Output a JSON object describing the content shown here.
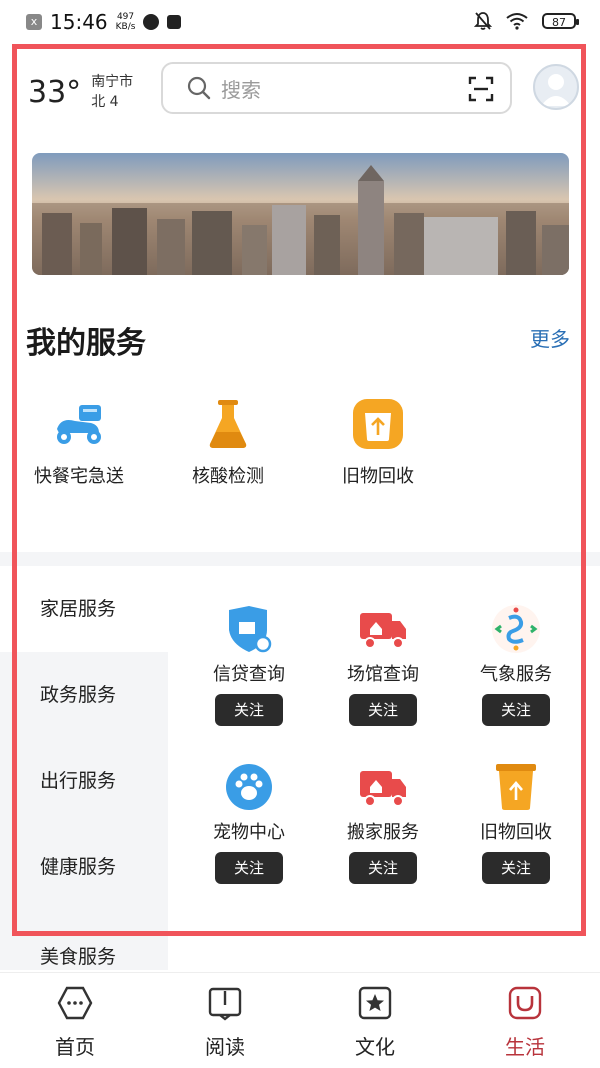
{
  "status_bar": {
    "badge": "x",
    "time": "15:46",
    "speed_value": "497",
    "speed_unit": "KB/s",
    "battery": "87"
  },
  "weather": {
    "temperature": "33°",
    "city": "南宁市",
    "wind": "北 4"
  },
  "search": {
    "placeholder": "搜索"
  },
  "my_services": {
    "title": "我的服务",
    "more": "更多",
    "items": [
      {
        "label": "快餐宅急送",
        "icon": "delivery-scooter-icon"
      },
      {
        "label": "核酸检测",
        "icon": "test-flask-icon"
      },
      {
        "label": "旧物回收",
        "icon": "recycle-icon"
      }
    ]
  },
  "categories": [
    "家居服务",
    "政务服务",
    "出行服务",
    "健康服务",
    "美食服务"
  ],
  "service_grid": {
    "follow_label": "关注",
    "items": [
      {
        "label": "信贷查询",
        "icon": "credit-shield-icon"
      },
      {
        "label": "场馆查询",
        "icon": "truck-icon"
      },
      {
        "label": "气象服务",
        "icon": "weather-logo-icon"
      },
      {
        "label": "宠物中心",
        "icon": "paw-icon"
      },
      {
        "label": "搬家服务",
        "icon": "truck-icon"
      },
      {
        "label": "旧物回收",
        "icon": "recycle-bin-icon"
      }
    ]
  },
  "bottom_nav": {
    "items": [
      {
        "label": "首页",
        "icon": "home-icon"
      },
      {
        "label": "阅读",
        "icon": "book-icon"
      },
      {
        "label": "文化",
        "icon": "star-icon"
      },
      {
        "label": "生活",
        "icon": "life-icon"
      }
    ],
    "active_color": "#b8333b"
  },
  "colors": {
    "accent_blue": "#2a6fb5",
    "frame_red": "#f0545a",
    "icon_blue": "#3a9de6",
    "icon_orange": "#f5a623",
    "icon_red": "#e84b4b"
  }
}
